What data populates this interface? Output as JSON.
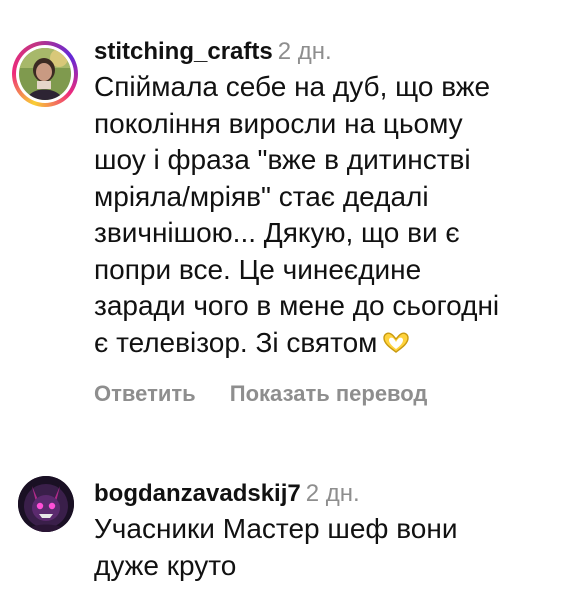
{
  "comments": [
    {
      "username": "stitching_crafts",
      "time": "2 дн.",
      "text_lines": [
        "Спіймала себе на дуб, що вже",
        "покоління виросли на цьому",
        "шоу і фраза \"вже в дитинстві",
        "мріяла/мріяв\" стає дедалі",
        "звичнішою... Дякую, що ви є",
        "попри все. Це чинеєдине",
        "заради чого в мене до сьогодні",
        "є телевізор. Зі святом"
      ],
      "emoji": "heart-hands-icon",
      "avatar_icon": "user-avatar-photo",
      "story_ring_colors": [
        "#f9ce34",
        "#ee2a7b",
        "#6228d7"
      ],
      "actions": {
        "reply": "Ответить",
        "translate": "Показать перевод"
      }
    },
    {
      "username": "bogdanzavadskij7",
      "time": "2 дн.",
      "text_lines": [
        "Учасники Мастер шеф вони",
        "дуже круто"
      ],
      "avatar_icon": "user-avatar-character"
    }
  ],
  "colors": {
    "text": "#111111",
    "muted": "#8e8e8e",
    "background": "#ffffff"
  }
}
